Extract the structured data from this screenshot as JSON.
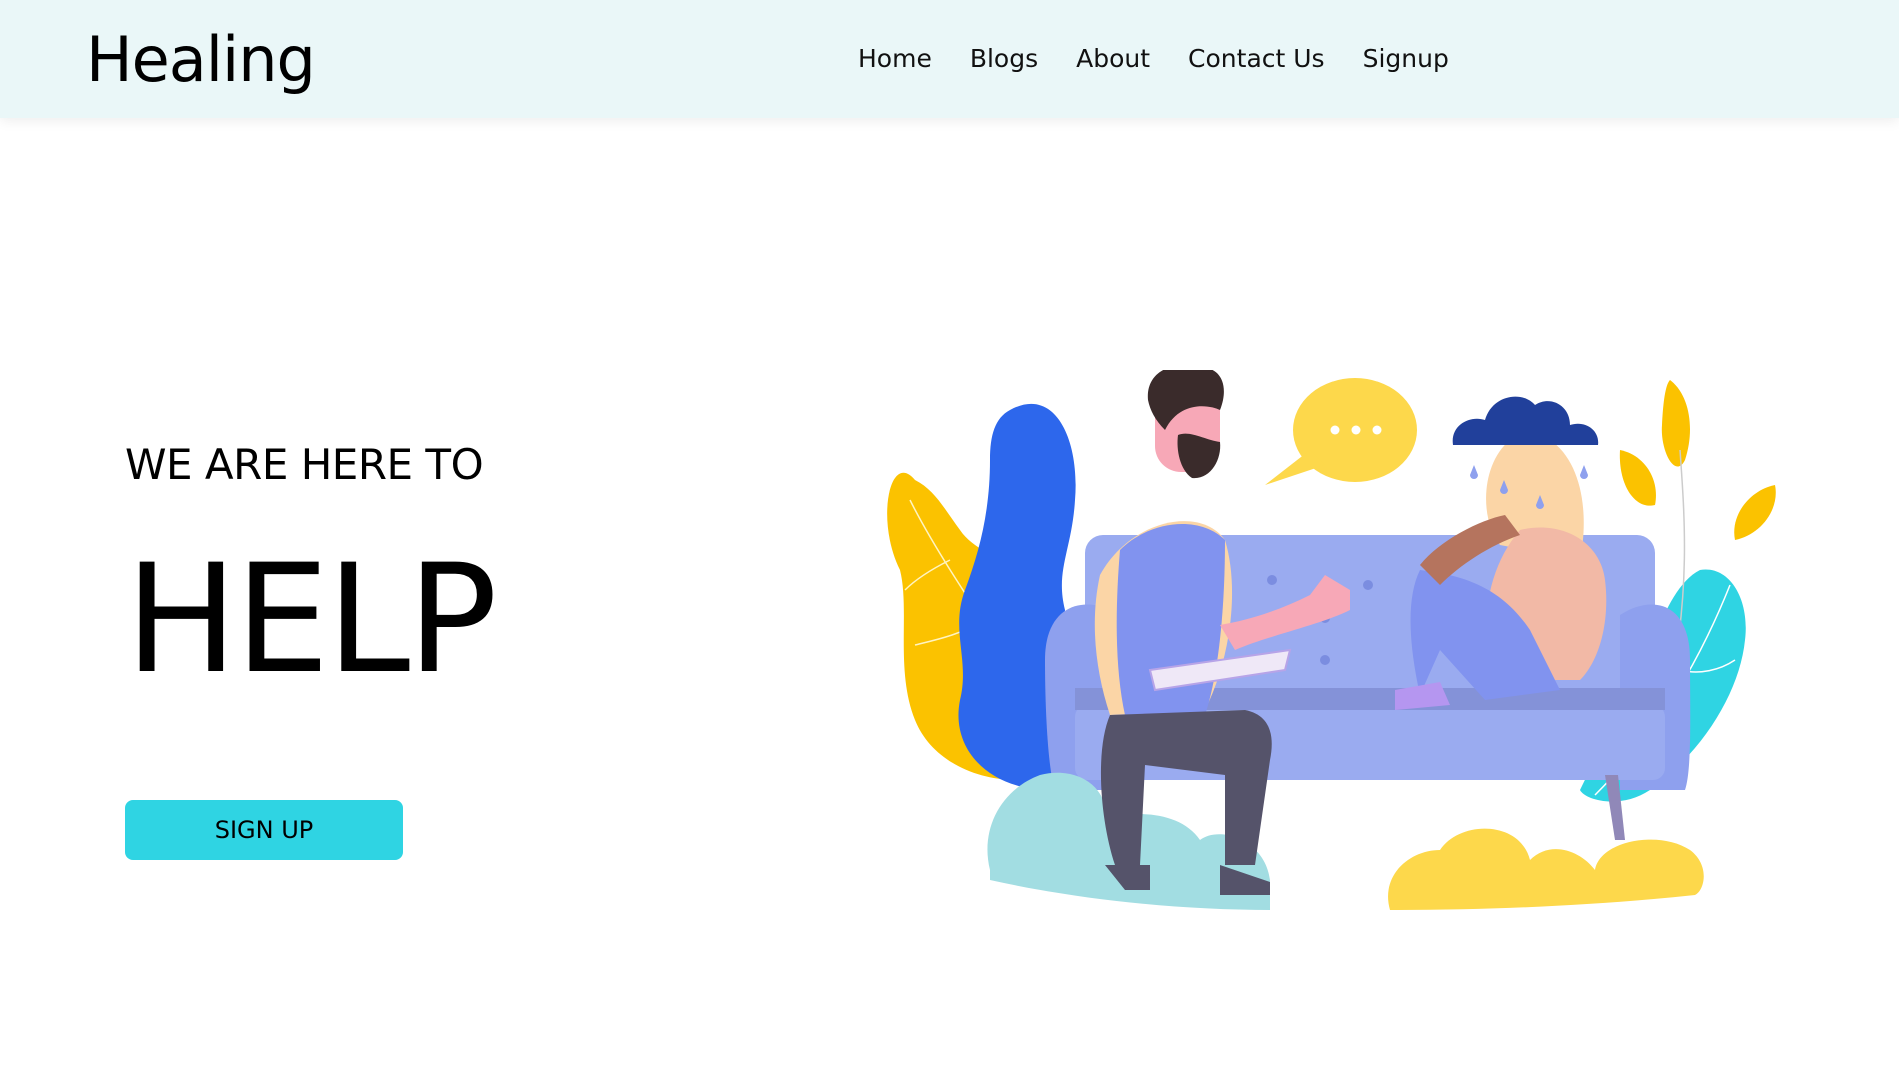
{
  "header": {
    "brand": "Healing",
    "nav": [
      {
        "label": "Home"
      },
      {
        "label": "Blogs"
      },
      {
        "label": "About"
      },
      {
        "label": "Contact Us"
      },
      {
        "label": "Signup"
      }
    ]
  },
  "hero": {
    "subtitle": "WE ARE HERE TO",
    "title": "HELP",
    "cta_label": "SIGN UP"
  },
  "colors": {
    "navbar_bg": "#eaf7f8",
    "button_bg": "#2fd4e3",
    "sofa": "#8ea0ee",
    "leaf_yellow": "#fbc200",
    "leaf_blue": "#2d67ec",
    "leaf_cyan": "#2fd4e3",
    "cloud": "#21409b",
    "bubble": "#fdd84b"
  },
  "illustration": {
    "subject": "therapy-session-illustration",
    "icons": [
      "speech-bubble-icon",
      "rain-cloud-icon"
    ]
  }
}
